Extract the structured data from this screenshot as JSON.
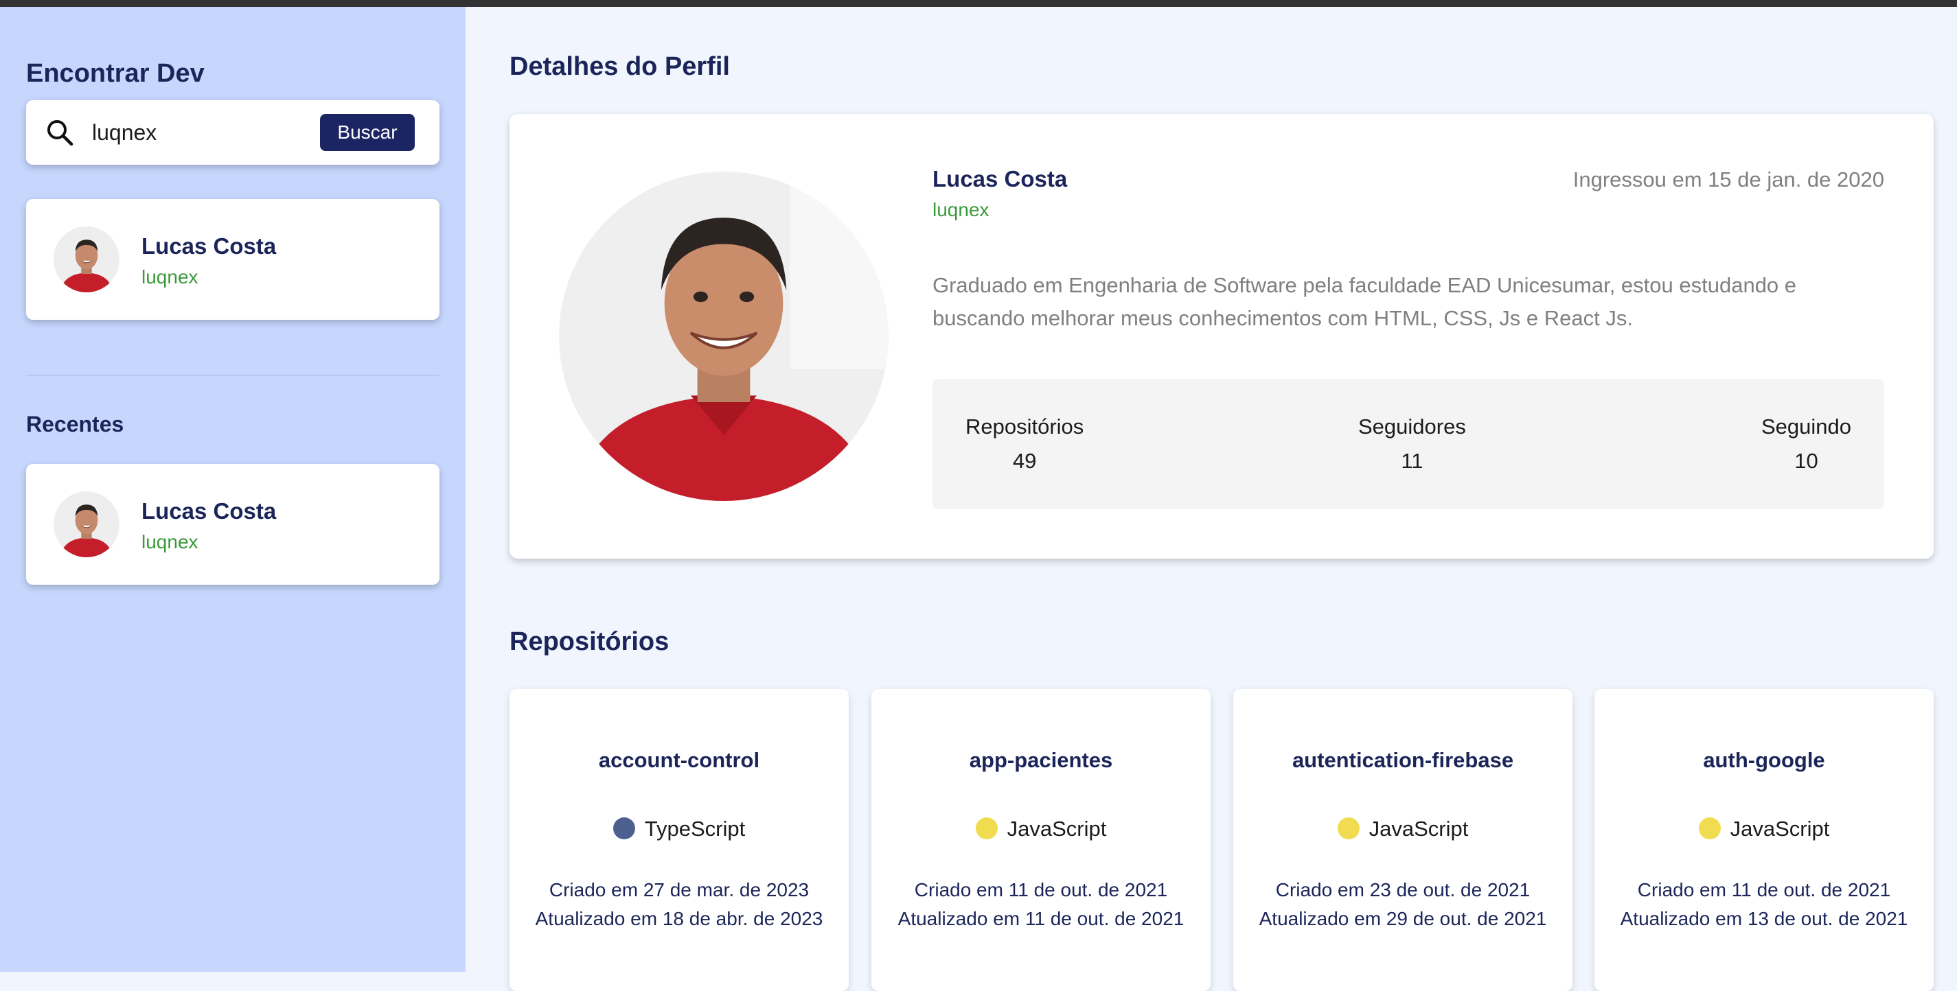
{
  "sidebar": {
    "title": "Encontrar Dev",
    "search": {
      "value": "luqnex",
      "button_label": "Buscar"
    },
    "result": {
      "name": "Lucas Costa",
      "login": "luqnex"
    },
    "recent_title": "Recentes",
    "recent": [
      {
        "name": "Lucas Costa",
        "login": "luqnex"
      }
    ]
  },
  "profile": {
    "section_title": "Detalhes do Perfil",
    "name": "Lucas Costa",
    "login": "luqnex",
    "joined": "Ingressou em 15 de jan. de 2020",
    "bio": "Graduado em Engenharia de Software pela faculdade EAD Unicesumar, estou estudando e buscando melhorar meus conhecimentos com HTML, CSS, Js e React Js.",
    "stats": [
      {
        "label": "Repositórios",
        "value": "49"
      },
      {
        "label": "Seguidores",
        "value": "11"
      },
      {
        "label": "Seguindo",
        "value": "10"
      }
    ]
  },
  "repos": {
    "section_title": "Repositórios",
    "items": [
      {
        "name": "account-control",
        "language": "TypeScript",
        "language_color": "#4d5f8f",
        "created": "Criado em 27 de mar. de 2023",
        "updated": "Atualizado em 18 de abr. de 2023"
      },
      {
        "name": "app-pacientes",
        "language": "JavaScript",
        "language_color": "#f0dc4e",
        "created": "Criado em 11 de out. de 2021",
        "updated": "Atualizado em 11 de out. de 2021"
      },
      {
        "name": "autentication-firebase",
        "language": "JavaScript",
        "language_color": "#f0dc4e",
        "created": "Criado em 23 de out. de 2021",
        "updated": "Atualizado em 29 de out. de 2021"
      },
      {
        "name": "auth-google",
        "language": "JavaScript",
        "language_color": "#f0dc4e",
        "created": "Criado em 11 de out. de 2021",
        "updated": "Atualizado em 13 de out. de 2021"
      }
    ]
  },
  "colors": {
    "accent": "#1b2564",
    "login_green": "#3a9a3a",
    "sidebar_bg": "#c6d6fd"
  }
}
